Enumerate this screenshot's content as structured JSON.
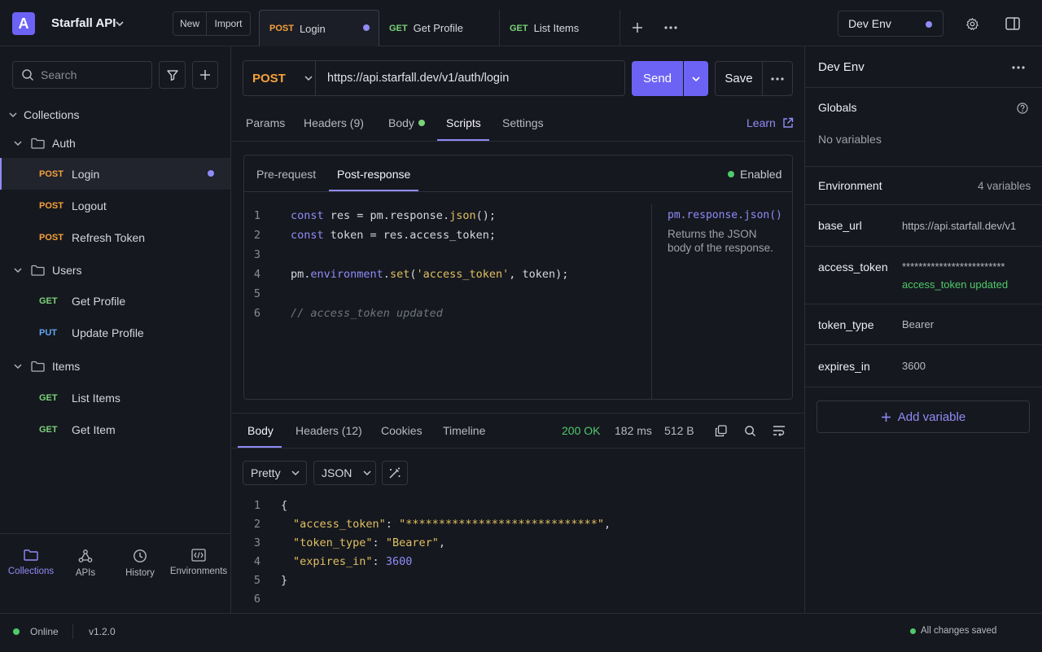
{
  "workspace": {
    "logo_letter": "A",
    "name": "Starfall API"
  },
  "top_actions": {
    "new_label": "New",
    "import_label": "Import"
  },
  "tabs": [
    {
      "method": "POST",
      "label": "Login",
      "unsaved": true
    },
    {
      "method": "GET",
      "label": "Get Profile"
    },
    {
      "method": "GET",
      "label": "List Items"
    }
  ],
  "env_selector": {
    "label": "Dev Env"
  },
  "sidebar": {
    "search_placeholder": "Search",
    "collections_label": "Collections",
    "folders": [
      {
        "name": "Auth",
        "items": [
          {
            "method": "POST",
            "label": "Login"
          },
          {
            "method": "POST",
            "label": "Logout"
          },
          {
            "method": "POST",
            "label": "Refresh Token"
          }
        ]
      },
      {
        "name": "Users",
        "items": [
          {
            "method": "GET",
            "label": "Get Profile"
          },
          {
            "method": "PUT",
            "label": "Update Profile"
          }
        ]
      },
      {
        "name": "Items",
        "items": [
          {
            "method": "GET",
            "label": "List Items"
          },
          {
            "method": "GET",
            "label": "Get Item"
          }
        ]
      }
    ],
    "nav": [
      "Collections",
      "APIs",
      "History",
      "Environments"
    ]
  },
  "request": {
    "method": "POST",
    "url": "https://api.starfall.dev/v1/auth/login",
    "send_label": "Send",
    "save_label": "Save",
    "tabs": [
      "Params",
      "Headers (9)",
      "Body",
      "Scripts",
      "Settings"
    ],
    "learn_label": "Learn"
  },
  "scripts": {
    "tabs": [
      "Pre-request",
      "Post-response"
    ],
    "enabled_label": "Enabled",
    "line_numbers": [
      "1",
      "2",
      "3",
      "4",
      "5",
      "6"
    ],
    "doc_title": "pm.response.json()",
    "doc_text": "Returns the JSON body of the response."
  },
  "response": {
    "tabs": [
      "Body",
      "Headers (12)",
      "Cookies",
      "Timeline"
    ],
    "status": "200 OK",
    "time": "182 ms",
    "size": "512 B",
    "format": "Pretty",
    "type": "JSON",
    "line_numbers": [
      "1",
      "2",
      "3",
      "4",
      "5",
      "6"
    ],
    "json": {
      "access_token_key": "\"access_token\"",
      "access_token_val": "\"*****************************\"",
      "token_type_key": "\"token_type\"",
      "token_type_val": "\"Bearer\"",
      "expires_in_key": "\"expires_in\"",
      "expires_in_val": "3600"
    }
  },
  "env_panel": {
    "title": "Dev Env",
    "globals_label": "Globals",
    "no_vars": "No variables",
    "environment_label": "Environment",
    "var_count": "4 variables",
    "variables": [
      {
        "name": "base_url",
        "value": "https://api.starfall.dev/v1"
      },
      {
        "name": "access_token",
        "value": "*************************",
        "note": "access_token updated"
      },
      {
        "name": "token_type",
        "value": "Bearer"
      },
      {
        "name": "expires_in",
        "value": "3600"
      }
    ],
    "add_label": "Add variable"
  },
  "status_bar": {
    "online": "Online",
    "version": "v1.2.0",
    "saved": "All changes saved"
  },
  "colors": {
    "accent": "#6c63f5",
    "post": "#f5a13a",
    "get": "#7ad37a",
    "put": "#5fa8f5",
    "success": "#4fca6a"
  }
}
